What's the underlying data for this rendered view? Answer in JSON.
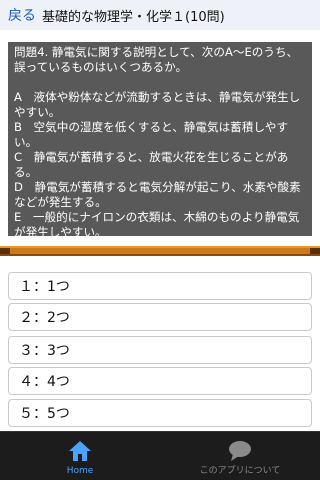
{
  "header": {
    "back_label": "戻る",
    "title": "基礎的な物理学・化学１(10問)"
  },
  "question": {
    "intro": "問題4. 静電気に関する説明として、次のA～Eのうち、誤っているものはいくつあるか。",
    "statements": [
      "A　液体や粉体などが流動するときは、静電気が発生しやすい。",
      "B　空気中の湿度を低くすると、静電気は蓄積しやすい。",
      "C　静電気が蓄積すると、放電火花を生じることがある。",
      "D　静電気が蓄積すると電気分解が起こり、水素や酸素などが発生する。",
      "E　一般的にナイロンの衣類は、木綿のものより静電気が発生しやすい。"
    ]
  },
  "choices": [
    {
      "label": "１：1つ"
    },
    {
      "label": "２：2つ"
    },
    {
      "label": "３：3つ"
    },
    {
      "label": "４：4つ"
    },
    {
      "label": "５：5つ"
    }
  ],
  "tabbar": {
    "tabs": [
      {
        "label": "Home",
        "icon": "home-icon",
        "active": true
      },
      {
        "label": "このアプリについて",
        "icon": "chat-bubble-icon",
        "active": false
      }
    ]
  },
  "colors": {
    "header_bg": "#eef2f8",
    "back_link": "#1a56c2",
    "question_bg": "#595959",
    "divider": "#cc7a1a",
    "tabbar_bg": "#1c1c1c",
    "active_tab": "#4da3ff"
  }
}
